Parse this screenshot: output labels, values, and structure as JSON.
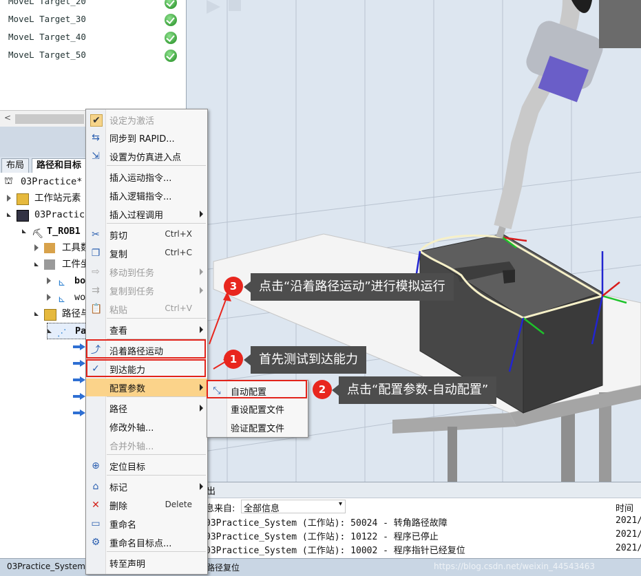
{
  "targets": [
    "MoveL Target_20",
    "MoveL Target_30",
    "MoveL Target_40",
    "MoveL Target_50"
  ],
  "tabs": [
    "布局",
    "路径和目标"
  ],
  "tree": {
    "station": "03Practice*",
    "items": [
      "工作站元素",
      "03Practice",
      "T_ROB1",
      "工具数据",
      "工件坐标",
      "bo",
      "wo",
      "路径与",
      "Pa"
    ]
  },
  "context_menu": [
    {
      "label": "设定为激活",
      "enabled": false,
      "icon": "check-icon"
    },
    {
      "label": "同步到 RAPID...",
      "icon": "sync-rapid-icon"
    },
    {
      "label": "设置为仿真进入点",
      "icon": "entry-point-icon"
    },
    {
      "label": "插入运动指令...",
      "icon": ""
    },
    {
      "label": "插入逻辑指令...",
      "icon": ""
    },
    {
      "label": "插入过程调用",
      "icon": "",
      "submenu": true
    },
    {
      "label": "剪切",
      "shortcut": "Ctrl+X",
      "icon": "scissors-icon"
    },
    {
      "label": "复制",
      "shortcut": "Ctrl+C",
      "icon": "copy-icon"
    },
    {
      "label": "移动到任务",
      "enabled": false,
      "submenu": true,
      "icon": "move-task-icon"
    },
    {
      "label": "复制到任务",
      "enabled": false,
      "submenu": true,
      "icon": "copy-task-icon"
    },
    {
      "label": "粘贴",
      "shortcut": "Ctrl+V",
      "enabled": false,
      "icon": "paste-icon"
    },
    {
      "label": "查看",
      "submenu": true,
      "icon": ""
    },
    {
      "label": "沿着路径运动",
      "icon": "move-along-path-icon"
    },
    {
      "label": "到达能力",
      "icon": "reachability-icon"
    },
    {
      "label": "配置参数",
      "submenu": true,
      "icon": ""
    },
    {
      "label": "路径",
      "submenu": true,
      "icon": ""
    },
    {
      "label": "修改外轴...",
      "icon": ""
    },
    {
      "label": "合并外轴...",
      "enabled": false,
      "icon": ""
    },
    {
      "label": "定位目标",
      "icon": "locate-target-icon"
    },
    {
      "label": "标记",
      "submenu": true,
      "icon": "tag-icon"
    },
    {
      "label": "删除",
      "shortcut": "Delete",
      "icon": "delete-icon"
    },
    {
      "label": "重命名",
      "icon": "rename-icon"
    },
    {
      "label": "重命名目标点...",
      "icon": "rename-targets-icon"
    },
    {
      "label": "转至声明",
      "icon": ""
    }
  ],
  "submenu": [
    {
      "label": "自动配置",
      "icon": "auto-config-icon"
    },
    {
      "label": "重设配置文件"
    },
    {
      "label": "验证配置文件"
    }
  ],
  "callouts": [
    {
      "num": "1",
      "text": "首先测试到达能力"
    },
    {
      "num": "2",
      "text": "点击“配置参数-自动配置”"
    },
    {
      "num": "3",
      "text": "点击“沿着路径运动”进行模拟运行"
    }
  ],
  "output": {
    "tab_label": "出",
    "filter_label": "息来自:",
    "filter_value": "全部信息",
    "time_header": "时间",
    "rows": [
      "03Practice_System (工作站): 50024 - 转角路径故障",
      "03Practice_System (工作站): 10122 - 程序已停止",
      "03Practice_System (工作站): 10002 - 程序指针已经复位"
    ],
    "times": [
      "2021/",
      "2021/",
      "2021/"
    ]
  },
  "status": {
    "system": "03Practice_System",
    "message": "路径复位",
    "watermark": "https://blog.csdn.net/weixin_44543463"
  },
  "colors": {
    "highlight": "#fbd38a",
    "callout_red": "#e8261e",
    "callout_bg": "#4d4d4d"
  }
}
